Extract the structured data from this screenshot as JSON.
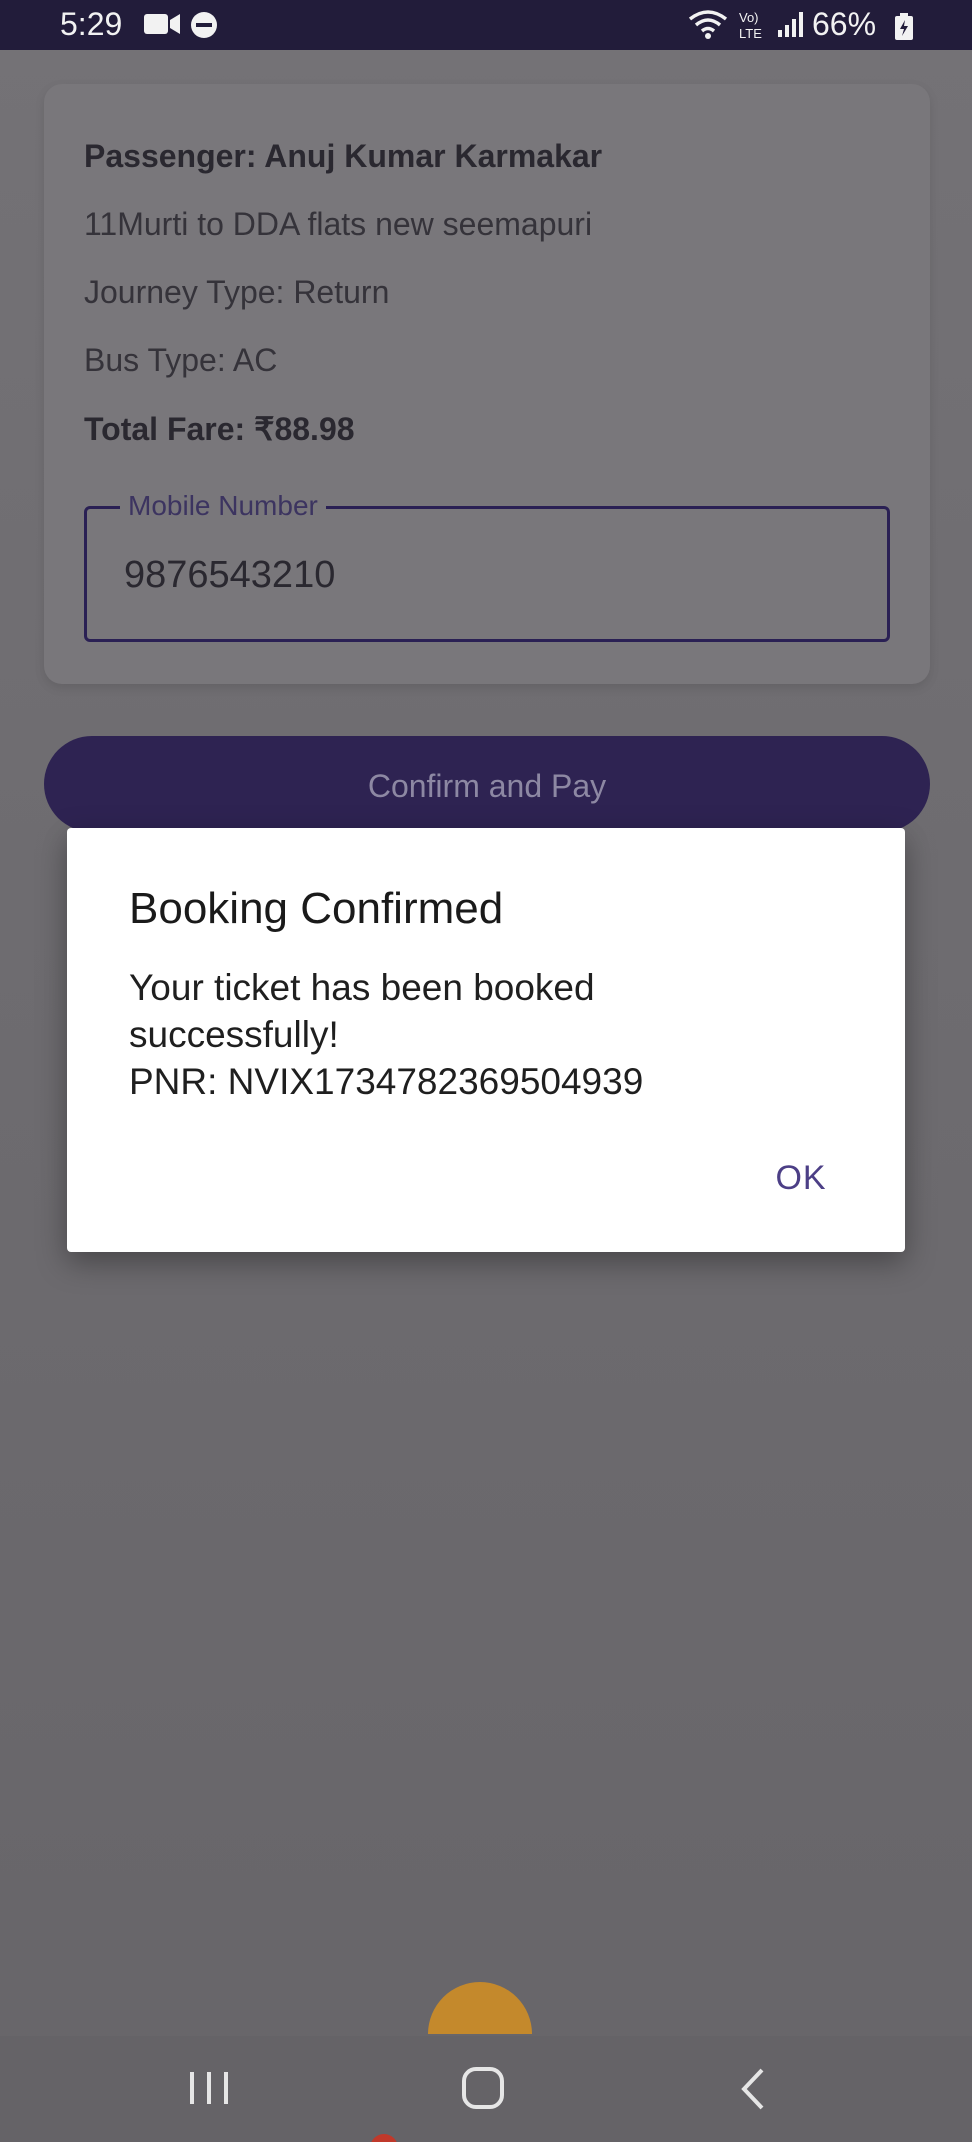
{
  "status_bar": {
    "time": "5:29",
    "battery": "66%",
    "icons": [
      "video-icon",
      "dnd-icon",
      "wifi-icon",
      "volte-icon",
      "signal-icon",
      "battery-icon"
    ]
  },
  "booking": {
    "passenger": "Passenger: Anuj Kumar Karmakar",
    "route": "11Murti to  DDA flats new seemapuri",
    "journey_type": "Journey Type: Return",
    "bus_type": "Bus Type: AC",
    "total_fare": "Total Fare: ₹88.98"
  },
  "mobile_field": {
    "label": "Mobile Number",
    "value": "9876543210"
  },
  "confirm_button": {
    "label": "Confirm and Pay"
  },
  "dialog": {
    "title": "Booking Confirmed",
    "message": "Your ticket has been booked\nsuccessfully!\nPNR: NVIX1734782369504939",
    "ok_label": "OK"
  },
  "colors": {
    "accent": "#2e2352",
    "dialog_action": "#4c3f86",
    "status_bar": "#221c3a",
    "fab": "#c4892c"
  },
  "nav_bar": {
    "icons": [
      "recents-icon",
      "home-icon",
      "back-icon"
    ]
  }
}
